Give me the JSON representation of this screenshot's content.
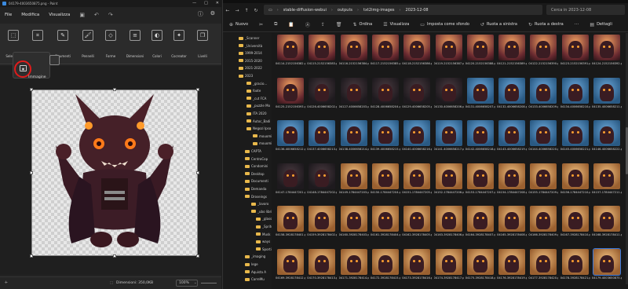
{
  "paint": {
    "title": "04179-4003650875.png - Paint",
    "window_controls": [
      "—",
      "□",
      "✕"
    ],
    "menu": [
      "File",
      "Modifica",
      "Visualizza"
    ],
    "menu_right": [
      "ⓘ",
      "⚙"
    ],
    "ribbon": [
      "Seleziona",
      "Immagine",
      "Strumenti",
      "Pennelli",
      "Forme",
      "Dimensioni",
      "Colori",
      "Cocreator",
      "Livelli"
    ],
    "dropdown_label": "Immagine",
    "status_dimensions": "Dimensioni: 350,0KB",
    "zoom": "100%"
  },
  "explorer": {
    "breadcrumb": [
      "stable-diffusion-webui",
      "outputs",
      "txt2img-images",
      "2023-12-08"
    ],
    "search_placeholder": "Cerca in 2023-12-08",
    "commands": [
      "Nuovo",
      "Ordina",
      "Visualizza",
      "Imposta come sfondo",
      "Ruota a sinistra",
      "Ruota a destra",
      "Dettagli"
    ],
    "nav": [
      "_Scanner",
      "_Università",
      "1999-2014",
      "2015-2020",
      "2021-2022",
      "2023",
      "_gracio...",
      "foote",
      "_cut FCA",
      "_puzzle Mo",
      "ITA 2020",
      "Autoc_Badi",
      "Negozi Ipso",
      "mouomil1",
      "mouomil2",
      "CAPTA",
      "CentroCop",
      "Condomini",
      "Desktop",
      "Documenti",
      "Demanda",
      "Droseings",
      "_lavoro",
      "_ubo libri",
      "_glass",
      "_Spritex",
      "Musk Box",
      "ways",
      "Sporting",
      "_imaging",
      "lege",
      "Aquista A",
      "CarreMu"
    ],
    "rows": [
      {
        "kind": "fire",
        "names": [
          "04114-2152156382.png",
          "04115-2152156383.png",
          "04116-2152156384.png",
          "04117-2152156385.png",
          "04118-2152156386.png",
          "04119-2152156387.png",
          "04120-2152156388.png",
          "04121-2152156389.png",
          "04122-2152156390.png",
          "04123-2152156391.png",
          "04124-2152156392.png"
        ]
      },
      {
        "kind": "mixed",
        "names": [
          "04125-2152156393.png",
          "04126-4006658202.png",
          "04127-4006658203.png",
          "04128-4006658204.png",
          "04129-4006658205.png",
          "04130-4006658206.png",
          "04131-4006658207.png",
          "04132-4006658208.png",
          "04133-4006658209.png",
          "04134-4006658210.png",
          "04135-4006658211.png"
        ]
      },
      {
        "kind": "blue",
        "names": [
          "04136-4006658212.png",
          "04137-4006658213.png",
          "04138-4006658214.png",
          "04139-4006658215.png",
          "04140-4006658216.png",
          "04141-4006658217.png",
          "04142-4006658218.png",
          "04143-4006658219.png",
          "04144-4006658220.png",
          "04145-4006658221.png",
          "04146-4006658222.png"
        ]
      },
      {
        "kind": "amber",
        "names": [
          "04147-1784447201.png",
          "04148-1784447202.png",
          "04149-1784447203.png",
          "04150-1784447204.png",
          "04151-1784447205.png",
          "04152-1784447206.png",
          "04153-1784447207.png",
          "04154-1784447208.png",
          "04155-1784447209.png",
          "04156-1784447210.png",
          "04157-1784447211.png"
        ]
      },
      {
        "kind": "amber",
        "names": [
          "04158-3928178401.png",
          "04159-3928178402.png",
          "04160-3928178403.png",
          "04161-3928178404.png",
          "04162-3928178405.png",
          "04163-3928178406.png",
          "04164-3928178407.png",
          "04165-3928178408.png",
          "04166-3928178409.png",
          "04167-3928178410.png",
          "04168-3928178411.png"
        ]
      },
      {
        "kind": "amber",
        "names": [
          "04169-3928178412.png",
          "04170-3928178413.png",
          "04171-3928178414.png",
          "04172-3928178415.png",
          "04173-3928178416.png",
          "04174-3928178417.png",
          "04175-3928178418.png",
          "04176-3928178419.png",
          "04177-3928178420.png",
          "04178-3928178421.png",
          "04179-4003650875.png"
        ]
      }
    ]
  },
  "colors": {
    "accent": "#3a7adf",
    "highlight": "#e01b1b",
    "folder": "#e8b84b"
  }
}
